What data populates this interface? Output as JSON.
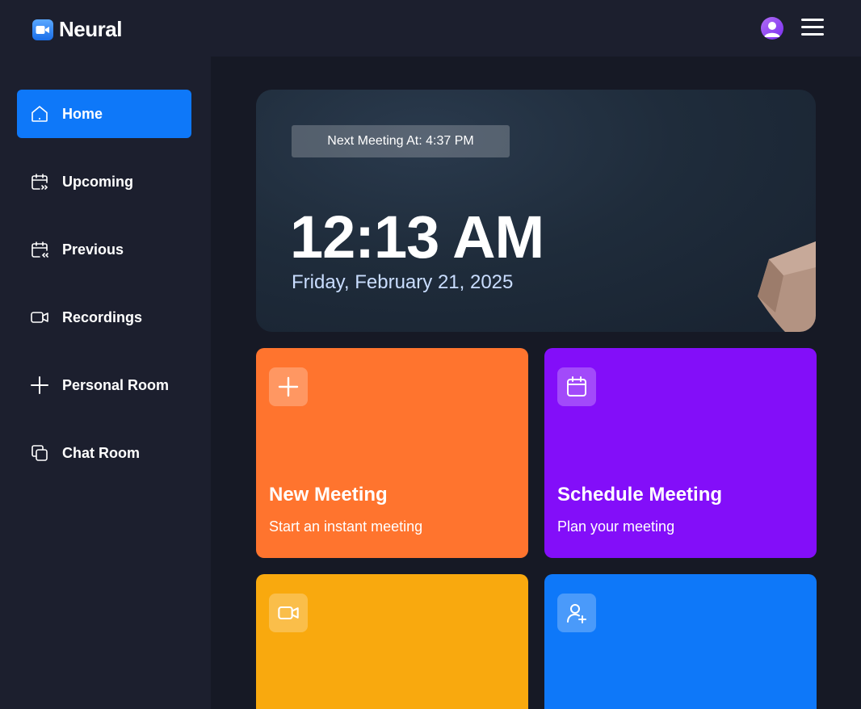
{
  "app": {
    "name": "Neural"
  },
  "header": {
    "avatar_icon": "user-avatar-icon",
    "menu_icon": "hamburger-menu-icon"
  },
  "sidebar": {
    "items": [
      {
        "label": "Home",
        "icon": "home-icon",
        "active": true
      },
      {
        "label": "Upcoming",
        "icon": "calendar-forward-icon",
        "active": false
      },
      {
        "label": "Previous",
        "icon": "calendar-back-icon",
        "active": false
      },
      {
        "label": "Recordings",
        "icon": "video-icon",
        "active": false
      },
      {
        "label": "Personal Room",
        "icon": "plus-icon",
        "active": false
      },
      {
        "label": "Chat Room",
        "icon": "copy-icon",
        "active": false
      }
    ]
  },
  "hero": {
    "next_meeting": "Next Meeting At: 4:37 PM",
    "time": "12:13 AM",
    "date": "Friday, February 21, 2025"
  },
  "cards": [
    {
      "title": "New Meeting",
      "subtitle": "Start an instant meeting",
      "icon": "plus-icon",
      "color": "#ff742e"
    },
    {
      "title": "Schedule Meeting",
      "subtitle": "Plan your meeting",
      "icon": "calendar-icon",
      "color": "#830ef9"
    },
    {
      "title": "",
      "subtitle": "",
      "icon": "video-icon",
      "color": "#f9a90e"
    },
    {
      "title": "",
      "subtitle": "",
      "icon": "add-user-icon",
      "color": "#0e78f9"
    }
  ],
  "colors": {
    "accent": "#0e78f9",
    "background": "#161925",
    "panel": "#1c1f2e"
  }
}
